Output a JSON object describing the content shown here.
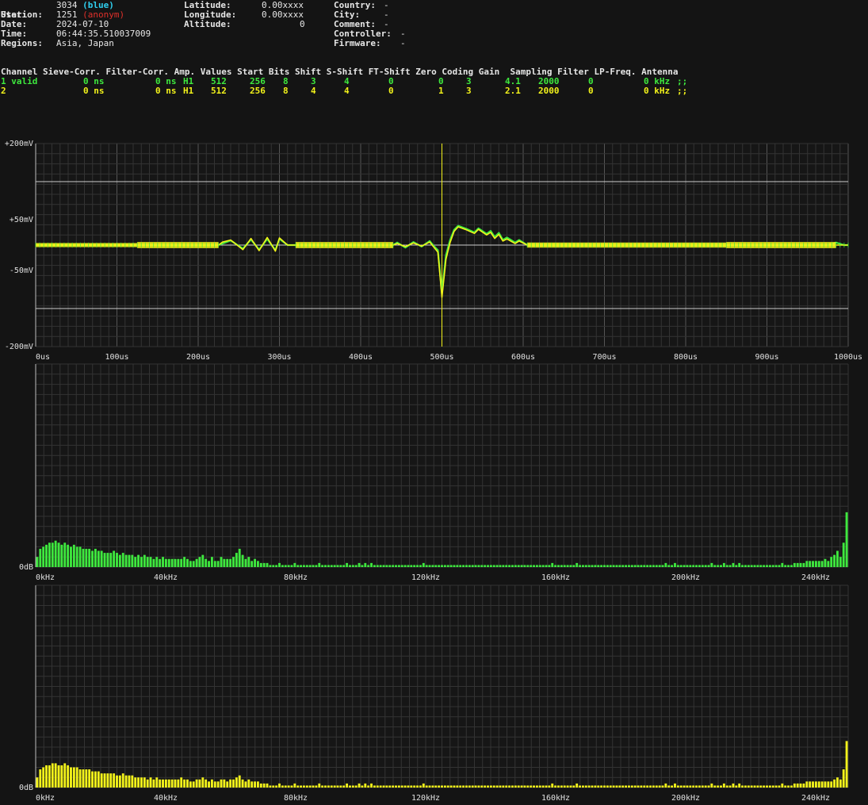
{
  "station_info": {
    "station_label": "Station:",
    "station_value": "3034",
    "station_color_name": "(blue)",
    "user_label": "User:",
    "user_value": "1251",
    "user_name": "(anonym)",
    "date_label": "Date:",
    "date_value": "2024-07-10",
    "time_label": "Time:",
    "time_value": "06:44:35.510037009",
    "regions_label": "Regions:",
    "regions_value": "Asia, Japan",
    "latitude_label": "Latitude:",
    "latitude_value": "0.00xxxx",
    "longitude_label": "Longitude:",
    "longitude_value": "0.00xxxx",
    "altitude_label": "Altitude:",
    "altitude_value": "0",
    "country_label": "Country:",
    "country_value": "-",
    "city_label": "City:",
    "city_value": "-",
    "comment_label": "Comment:",
    "comment_value": "-",
    "controller_label": "Controller:",
    "controller_value": "-",
    "firmware_label": "Firmware:",
    "firmware_value": "-"
  },
  "channel_table": {
    "headers": [
      "Channel",
      "Sieve-Corr.",
      "Filter-Corr.",
      "Amp.",
      "Values",
      "Start",
      "Bits",
      "Shift",
      "S-Shift",
      "FT-Shift",
      "Zero",
      "Coding",
      "Gain",
      "Sampling",
      "Filter",
      "LP-Freq.",
      "Antenna"
    ],
    "rows": [
      {
        "channel": "1 valid",
        "sieve": "0 ns",
        "filter_corr": "0 ns",
        "amp": "H1",
        "values": "512",
        "start": "256",
        "bits": "8",
        "shift": "3",
        "s_shift": "4",
        "ft_shift": "0",
        "zero": "0",
        "coding": "3",
        "gain": "4.1",
        "sampling": "2000",
        "filter": "0",
        "lp_freq": "0 kHz",
        "antenna": ";;",
        "color": "#3ee83e"
      },
      {
        "channel": "2",
        "sieve": "0 ns",
        "filter_corr": "0 ns",
        "amp": "H1",
        "values": "512",
        "start": "256",
        "bits": "8",
        "shift": "4",
        "s_shift": "4",
        "ft_shift": "0",
        "zero": "1",
        "coding": "3",
        "gain": "2.1",
        "sampling": "2000",
        "filter": "0",
        "lp_freq": "0 kHz",
        "antenna": ";;",
        "color": "#f2f21a"
      }
    ]
  },
  "chart_data": [
    {
      "type": "line",
      "y_tick_labels": [
        "+200mV",
        "+50mV",
        "-50mV",
        "-200mV"
      ],
      "y_ticks": [
        200,
        50,
        -50,
        -200
      ],
      "ylim": [
        -200,
        200
      ],
      "xlim": [
        0,
        1000
      ],
      "x_tick_labels": [
        "0us",
        "100us",
        "200us",
        "300us",
        "400us",
        "500us",
        "600us",
        "700us",
        "800us",
        "900us",
        "1000us"
      ],
      "x_ticks": [
        0,
        100,
        200,
        300,
        400,
        500,
        600,
        700,
        800,
        900,
        1000
      ],
      "reference_lines_mV": [
        125,
        -125
      ],
      "trigger_marker_us": 500,
      "grid": true,
      "series": [
        {
          "color": "#3ee83e",
          "x": [
            0,
            100,
            125,
            225,
            230,
            240,
            255,
            265,
            275,
            285,
            295,
            300,
            310,
            320,
            440,
            445,
            455,
            465,
            475,
            485,
            490,
            495,
            500,
            505,
            510,
            515,
            520,
            530,
            540,
            545,
            555,
            560,
            565,
            570,
            575,
            580,
            590,
            595,
            605,
            800,
            850,
            880,
            975,
            985,
            995,
            1000
          ],
          "y": [
            0,
            0,
            0,
            0,
            3,
            9,
            -7,
            11,
            -9,
            12,
            -10,
            12,
            0,
            0,
            0,
            5,
            -5,
            6,
            -3,
            8,
            -2,
            -10,
            -95,
            -20,
            10,
            30,
            38,
            32,
            25,
            33,
            22,
            28,
            16,
            24,
            10,
            15,
            5,
            10,
            0,
            0,
            0,
            0,
            0,
            5,
            0,
            0
          ]
        },
        {
          "color": "#f2f21a",
          "x": [
            0,
            100,
            125,
            225,
            230,
            240,
            255,
            265,
            275,
            285,
            295,
            300,
            310,
            320,
            440,
            445,
            455,
            465,
            475,
            485,
            490,
            495,
            500,
            505,
            510,
            515,
            520,
            530,
            540,
            545,
            555,
            560,
            565,
            570,
            575,
            580,
            590,
            595,
            605,
            800,
            850,
            880,
            975,
            985,
            995,
            1000
          ],
          "y": [
            0,
            0,
            0,
            0,
            6,
            10,
            -9,
            13,
            -11,
            15,
            -12,
            14,
            0,
            0,
            0,
            3,
            -3,
            4,
            -2,
            6,
            -4,
            -14,
            -103,
            -28,
            5,
            27,
            36,
            30,
            23,
            31,
            20,
            25,
            13,
            21,
            8,
            12,
            3,
            8,
            0,
            0,
            0,
            0,
            0,
            0,
            0,
            0
          ]
        }
      ]
    },
    {
      "type": "bar",
      "series_color": "#3ee83e",
      "xlim": [
        0,
        250
      ],
      "x_tick_labels": [
        "0kHz",
        "40kHz",
        "80kHz",
        "120kHz",
        "160kHz",
        "200kHz",
        "240kHz"
      ],
      "x_ticks": [
        0,
        40,
        80,
        120,
        160,
        200,
        240
      ],
      "y_tick_labels": [
        "0dB"
      ],
      "ymax": 100,
      "grid": true,
      "x_step_kHz": 1.0,
      "values": [
        5,
        9,
        10,
        11,
        12,
        12,
        13,
        12,
        11,
        12,
        11,
        10,
        11,
        10,
        10,
        9,
        9,
        9,
        8,
        9,
        8,
        8,
        7,
        7,
        7,
        8,
        7,
        6,
        7,
        6,
        6,
        6,
        5,
        6,
        5,
        6,
        5,
        5,
        4,
        5,
        4,
        5,
        4,
        4,
        4,
        4,
        4,
        4,
        5,
        4,
        3,
        3,
        4,
        5,
        6,
        4,
        3,
        5,
        3,
        3,
        5,
        4,
        4,
        4,
        5,
        7,
        9,
        6,
        4,
        5,
        3,
        4,
        3,
        2,
        2,
        2,
        1,
        1,
        1,
        2,
        1,
        1,
        1,
        1,
        2,
        1,
        1,
        1,
        1,
        1,
        1,
        1,
        2,
        1,
        1,
        1,
        1,
        1,
        1,
        1,
        1,
        2,
        1,
        1,
        1,
        2,
        1,
        2,
        1,
        2,
        1,
        1,
        1,
        1,
        1,
        1,
        1,
        1,
        1,
        1,
        1,
        1,
        1,
        1,
        1,
        1,
        2,
        1,
        1,
        1,
        1,
        1,
        1,
        1,
        1,
        1,
        1,
        1,
        1,
        1,
        1,
        1,
        1,
        1,
        1,
        1,
        1,
        1,
        1,
        1,
        1,
        1,
        1,
        1,
        1,
        1,
        1,
        1,
        1,
        1,
        1,
        1,
        1,
        1,
        1,
        1,
        1,
        1,
        2,
        1,
        1,
        1,
        1,
        1,
        1,
        1,
        2,
        1,
        1,
        1,
        1,
        1,
        1,
        1,
        1,
        1,
        1,
        1,
        1,
        1,
        1,
        1,
        1,
        1,
        1,
        1,
        1,
        1,
        1,
        1,
        1,
        1,
        1,
        1,
        1,
        2,
        1,
        1,
        2,
        1,
        1,
        1,
        1,
        1,
        1,
        1,
        1,
        1,
        1,
        1,
        2,
        1,
        1,
        1,
        2,
        1,
        1,
        2,
        1,
        2,
        1,
        1,
        1,
        1,
        1,
        1,
        1,
        1,
        1,
        1,
        1,
        1,
        1,
        2,
        1,
        1,
        1,
        2,
        2,
        2,
        2,
        3,
        3,
        3,
        3,
        3,
        3,
        4,
        3,
        5,
        6,
        8,
        5,
        12,
        27
      ]
    },
    {
      "type": "bar",
      "series_color": "#f2f21a",
      "xlim": [
        0,
        250
      ],
      "x_tick_labels": [
        "0kHz",
        "40kHz",
        "80kHz",
        "120kHz",
        "160kHz",
        "200kHz",
        "240kHz"
      ],
      "x_ticks": [
        0,
        40,
        80,
        120,
        160,
        200,
        240
      ],
      "y_tick_labels": [
        "0dB"
      ],
      "ymax": 100,
      "grid": true,
      "x_step_kHz": 1.0,
      "values": [
        5,
        9,
        10,
        11,
        11,
        12,
        12,
        11,
        11,
        12,
        11,
        10,
        10,
        10,
        9,
        9,
        9,
        9,
        8,
        8,
        8,
        7,
        7,
        7,
        7,
        7,
        6,
        6,
        7,
        6,
        6,
        6,
        5,
        5,
        5,
        5,
        4,
        5,
        4,
        5,
        4,
        4,
        4,
        4,
        4,
        4,
        4,
        5,
        4,
        4,
        3,
        3,
        4,
        4,
        5,
        4,
        3,
        4,
        3,
        3,
        4,
        4,
        3,
        4,
        4,
        5,
        6,
        4,
        3,
        4,
        3,
        3,
        3,
        2,
        2,
        2,
        1,
        1,
        1,
        2,
        1,
        1,
        1,
        1,
        2,
        1,
        1,
        1,
        1,
        1,
        1,
        1,
        2,
        1,
        1,
        1,
        1,
        1,
        1,
        1,
        1,
        2,
        1,
        1,
        1,
        2,
        1,
        2,
        1,
        2,
        1,
        1,
        1,
        1,
        1,
        1,
        1,
        1,
        1,
        1,
        1,
        1,
        1,
        1,
        1,
        1,
        2,
        1,
        1,
        1,
        1,
        1,
        1,
        1,
        1,
        1,
        1,
        1,
        1,
        1,
        1,
        1,
        1,
        1,
        1,
        1,
        1,
        1,
        1,
        1,
        1,
        1,
        1,
        1,
        1,
        1,
        1,
        1,
        1,
        1,
        1,
        1,
        1,
        1,
        1,
        1,
        1,
        1,
        2,
        1,
        1,
        1,
        1,
        1,
        1,
        1,
        2,
        1,
        1,
        1,
        1,
        1,
        1,
        1,
        1,
        1,
        1,
        1,
        1,
        1,
        1,
        1,
        1,
        1,
        1,
        1,
        1,
        1,
        1,
        1,
        1,
        1,
        1,
        1,
        1,
        2,
        1,
        1,
        2,
        1,
        1,
        1,
        1,
        1,
        1,
        1,
        1,
        1,
        1,
        1,
        2,
        1,
        1,
        1,
        2,
        1,
        1,
        2,
        1,
        2,
        1,
        1,
        1,
        1,
        1,
        1,
        1,
        1,
        1,
        1,
        1,
        1,
        1,
        2,
        1,
        1,
        1,
        2,
        2,
        2,
        2,
        3,
        3,
        3,
        3,
        3,
        3,
        3,
        3,
        3,
        4,
        5,
        4,
        9,
        23
      ]
    }
  ]
}
